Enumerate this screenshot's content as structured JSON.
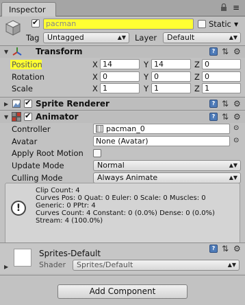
{
  "tab": {
    "label": "Inspector"
  },
  "header": {
    "object_name": "pacman",
    "static_label": "Static",
    "tag_label": "Tag",
    "tag_value": "Untagged",
    "layer_label": "Layer",
    "layer_value": "Default"
  },
  "transform": {
    "title": "Transform",
    "rows": [
      {
        "label": "Position",
        "x": "14",
        "y": "14",
        "z": "0"
      },
      {
        "label": "Rotation",
        "x": "0",
        "y": "0",
        "z": "0"
      },
      {
        "label": "Scale",
        "x": "1",
        "y": "1",
        "z": "1"
      }
    ],
    "axis_x": "X",
    "axis_y": "Y",
    "axis_z": "Z"
  },
  "sprite_renderer": {
    "title": "Sprite Renderer"
  },
  "animator": {
    "title": "Animator",
    "controller_label": "Controller",
    "controller_value": "pacman_0",
    "avatar_label": "Avatar",
    "avatar_value": "None (Avatar)",
    "apply_root_motion_label": "Apply Root Motion",
    "update_mode_label": "Update Mode",
    "update_mode_value": "Normal",
    "culling_mode_label": "Culling Mode",
    "culling_mode_value": "Always Animate",
    "info_lines": [
      "Clip Count: 4",
      "Curves Pos: 0 Quat: 0 Euler: 0 Scale: 0 Muscles: 0",
      "Generic: 0 PPtr: 4",
      "Curves Count: 4 Constant: 0 (0.0%) Dense: 0 (0.0%)",
      "Stream: 4 (100.0%)"
    ]
  },
  "material": {
    "name": "Sprites-Default",
    "shader_label": "Shader",
    "shader_value": "Sprites/Default"
  },
  "add_component_label": "Add Component"
}
